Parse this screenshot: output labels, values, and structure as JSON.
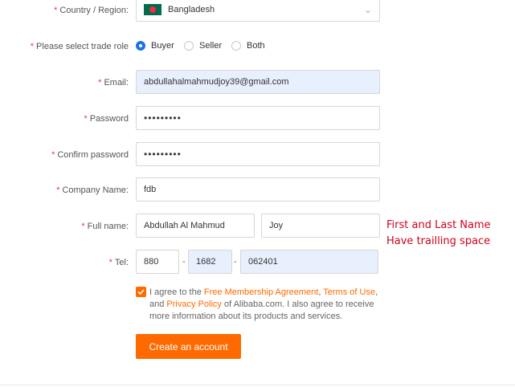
{
  "form": {
    "country": {
      "label": "Country / Region:",
      "value": "Bangladesh"
    },
    "trade_role": {
      "label": "Please select trade role",
      "options": [
        "Buyer",
        "Seller",
        "Both"
      ],
      "selected": "Buyer"
    },
    "email": {
      "label": "Email:",
      "value": "abdullahalmahmudjoy39@gmail.com"
    },
    "password": {
      "label": "Password",
      "value": "•••••••••"
    },
    "confirm_password": {
      "label": "Confirm password",
      "value": "•••••••••"
    },
    "company": {
      "label": "Company Name:",
      "value": "fdb"
    },
    "full_name": {
      "label": "Full name:",
      "first": "Abdullah Al Mahmud",
      "last": "Joy"
    },
    "tel": {
      "label": "Tel:",
      "country_code": "880",
      "area_code": "1682",
      "number": "062401",
      "sep1": "-",
      "sep2": "-"
    },
    "agreement": {
      "p1": "I agree to the ",
      "link1": "Free Membership Agreement",
      "p2": ", ",
      "link2": "Terms of Use",
      "p3": ", and ",
      "link3": "Privacy Policy",
      "p4": " of Alibaba.com. I also agree to receive more information about its products and services.",
      "checked": true
    },
    "submit_label": "Create an account"
  },
  "required_mark": "*",
  "annotation": {
    "line1": "First and Last Name",
    "line2": "Have trailling space"
  },
  "colors": {
    "accent": "#ff6a00",
    "required": "#e4393c",
    "radio_selected": "#1a73e8",
    "autofill": "#e8f0fe",
    "annotation": "#d0021b"
  }
}
